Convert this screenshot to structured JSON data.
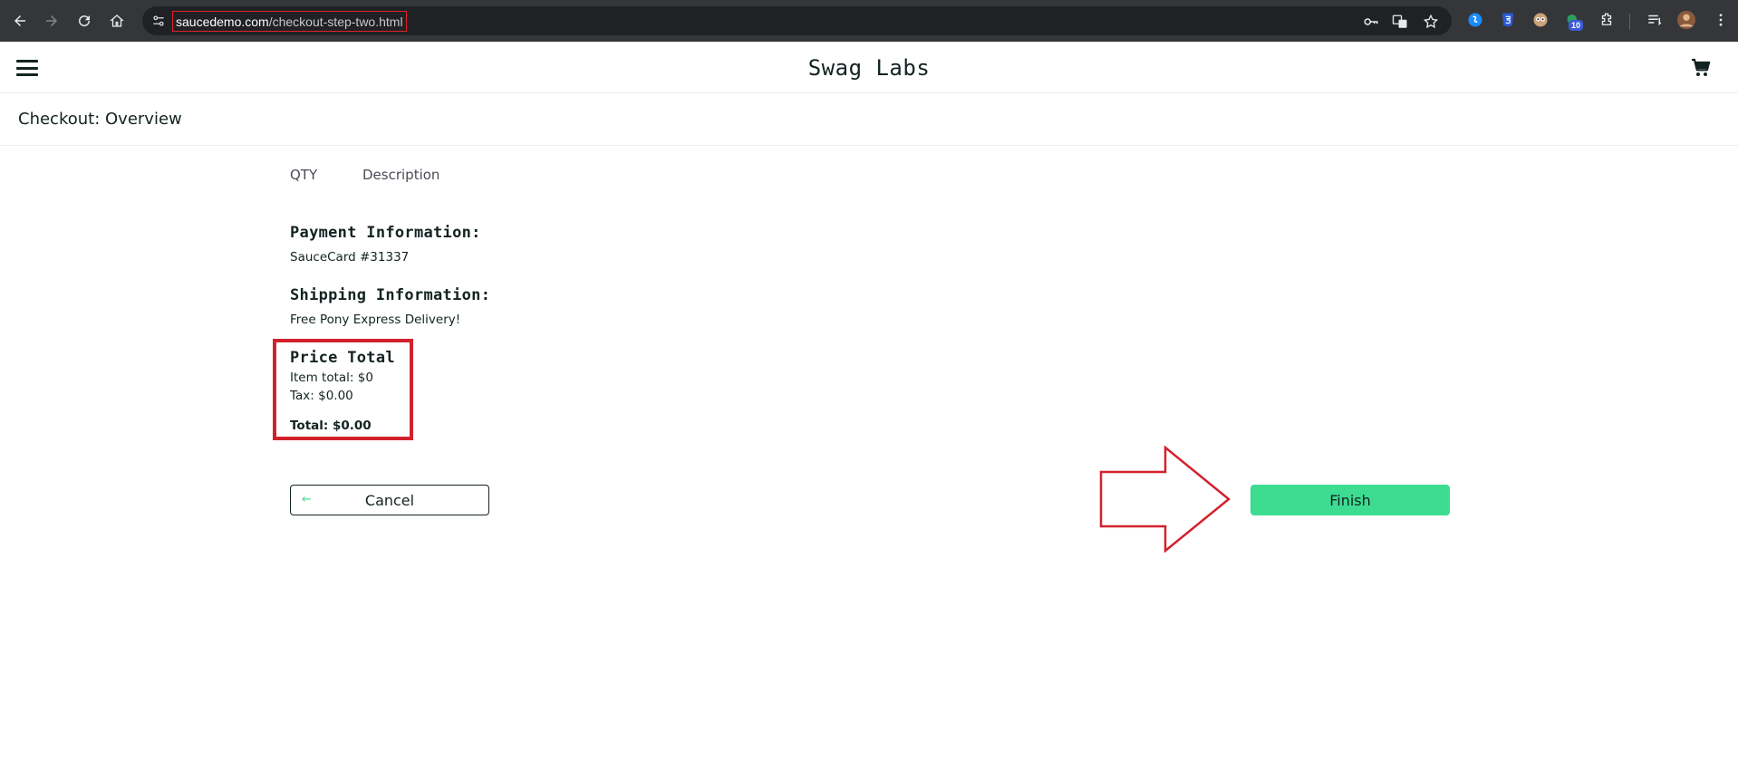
{
  "browser": {
    "url_domain": "saucedemo.com",
    "url_path": "/checkout-step-two.html",
    "extension_badge": "10"
  },
  "header": {
    "logo": "Swag Labs"
  },
  "page": {
    "title": "Checkout: Overview",
    "columns": {
      "qty": "QTY",
      "description": "Description"
    }
  },
  "summary": {
    "payment_label": "Payment Information:",
    "payment_value": "SauceCard #31337",
    "shipping_label": "Shipping Information:",
    "shipping_value": "Free Pony Express Delivery!",
    "price_label": "Price Total",
    "item_total": "Item total: $0",
    "tax": "Tax: $0.00",
    "total": "Total: $0.00"
  },
  "actions": {
    "cancel_label": "Cancel",
    "cancel_arrow": "←",
    "finish_label": "Finish"
  },
  "colors": {
    "accent_green": "#3ddc91",
    "annotation_red": "#d3212c",
    "text_dark": "#132322"
  }
}
